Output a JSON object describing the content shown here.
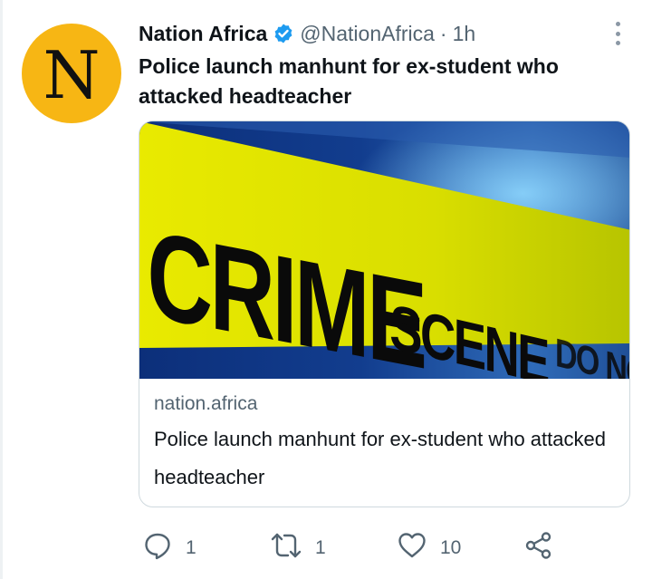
{
  "tweet": {
    "avatar_letter": "N",
    "display_name": "Nation Africa",
    "handle": "@NationAfrica",
    "separator": "·",
    "time": "1h",
    "text": "Police launch manhunt for ex-student who attacked headteacher"
  },
  "card": {
    "image_tape_words": "CRIME SCENE DO NOT CROSS",
    "domain": "nation.africa",
    "title": "Police launch manhunt for ex-student who attacked headteacher"
  },
  "actions": {
    "reply_count": "1",
    "retweet_count": "1",
    "like_count": "10"
  },
  "icons": {
    "verified": "verified-badge-icon",
    "more": "more-vertical-icon",
    "reply": "reply-icon",
    "retweet": "retweet-icon",
    "like": "heart-icon",
    "share": "share-icon"
  },
  "colors": {
    "avatar_bg": "#f7b614",
    "verified_blue": "#1d9bf0",
    "secondary_text": "#536471",
    "tape_yellow": "#e8e600"
  }
}
